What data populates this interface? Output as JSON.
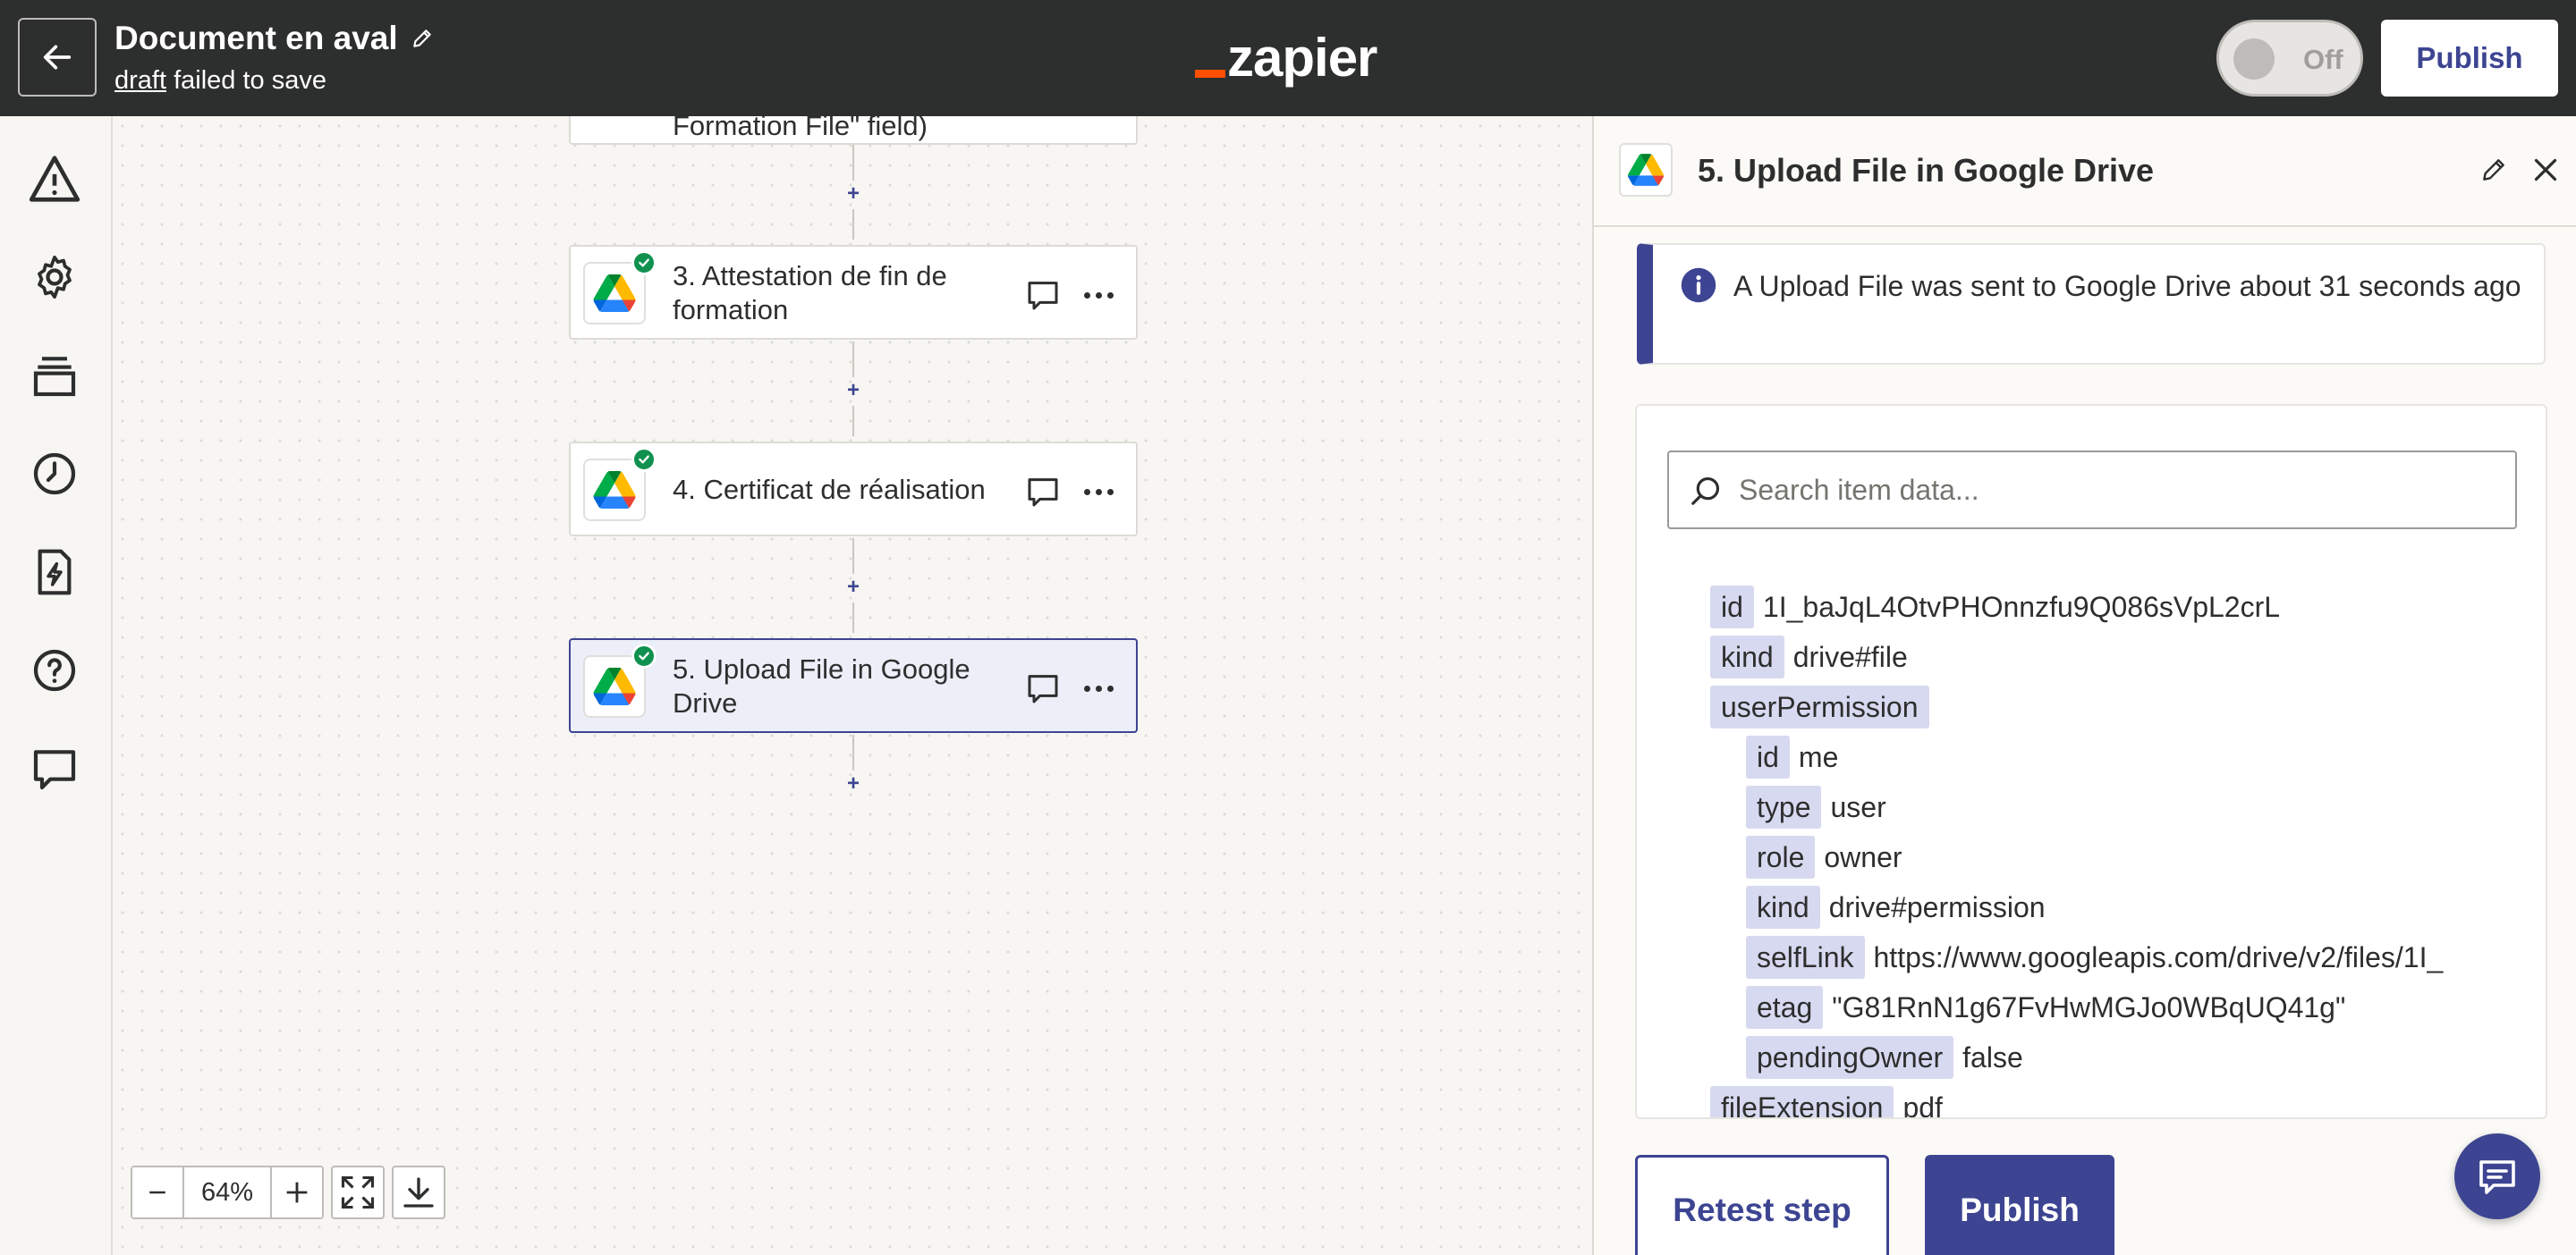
{
  "header": {
    "title": "Document en aval",
    "draft_link": "draft",
    "draft_status": " failed to save",
    "logo_text": "zapier",
    "toggle_label": "Off",
    "publish_label": "Publish"
  },
  "rail": {
    "icons": [
      "warning-icon",
      "gear-icon",
      "stack-icon",
      "clock-icon",
      "file-zap-icon",
      "help-icon",
      "chat-icon"
    ]
  },
  "canvas": {
    "partial_step_label": "Formation File\" field)",
    "steps": [
      {
        "label": "3. Attestation de fin de formation",
        "app": "google-drive-icon",
        "status": "success"
      },
      {
        "label": "4. Certificat de réalisation",
        "app": "google-drive-icon",
        "status": "success"
      },
      {
        "label": "5. Upload File in Google Drive",
        "app": "google-drive-icon",
        "status": "success",
        "selected": true
      }
    ],
    "plus_label": "+",
    "zoom": {
      "minus": "−",
      "level": "64%",
      "plus": "+"
    }
  },
  "panel": {
    "title": "5. Upload File in Google Drive",
    "info_text": "A Upload File was sent to Google Drive about 31 seconds ago",
    "search_placeholder": "Search item data...",
    "rows": [
      {
        "key": "id",
        "value": "1I_baJqL4OtvPHOnnzfu9Q086sVpL2crL",
        "level": 0
      },
      {
        "key": "kind",
        "value": "drive#file",
        "level": 0
      },
      {
        "key": "userPermission",
        "value": "",
        "level": 0
      },
      {
        "key": "id",
        "value": "me",
        "level": 1
      },
      {
        "key": "type",
        "value": "user",
        "level": 1
      },
      {
        "key": "role",
        "value": "owner",
        "level": 1
      },
      {
        "key": "kind",
        "value": "drive#permission",
        "level": 1
      },
      {
        "key": "selfLink",
        "value": "https://www.googleapis.com/drive/v2/files/1I_",
        "level": 1
      },
      {
        "key": "etag",
        "value": "\"G81RnN1g67FvHwMGJo0WBqUQ41g\"",
        "level": 1
      },
      {
        "key": "pendingOwner",
        "value": "false",
        "level": 1
      },
      {
        "key": "fileExtension",
        "value": "pdf",
        "level": 0
      }
    ],
    "retest_label": "Retest step",
    "publish_label": "Publish"
  },
  "colors": {
    "topbar": "#2d2e2e",
    "accent": "#3d4592",
    "brand_orange": "#ff4f00",
    "success": "#10914f",
    "key_chip": "#d7d9f0"
  }
}
